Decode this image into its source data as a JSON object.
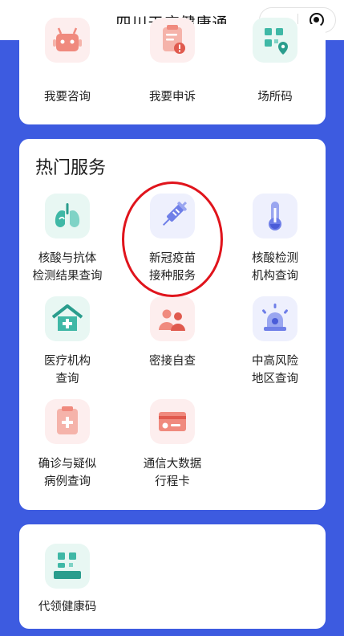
{
  "app": {
    "title": "四川天府健康通"
  },
  "top_card": {
    "items": [
      {
        "label": "我要咨询",
        "icon": "robot-icon"
      },
      {
        "label": "我要申诉",
        "icon": "complaint-clipboard-icon"
      },
      {
        "label": "场所码",
        "icon": "venue-qr-location-icon"
      }
    ]
  },
  "hot_services": {
    "title": "热门服务",
    "items": [
      {
        "label_line1": "核酸与抗体",
        "label_line2": "检测结果查询",
        "icon": "lungs-icon"
      },
      {
        "label_line1": "新冠疫苗",
        "label_line2": "接种服务",
        "icon": "syringe-icon"
      },
      {
        "label_line1": "核酸检测",
        "label_line2": "机构查询",
        "icon": "thermometer-icon"
      },
      {
        "label_line1": "医疗机构",
        "label_line2": "查询",
        "icon": "hospital-icon"
      },
      {
        "label_line1": "密接自查",
        "label_line2": "",
        "icon": "close-contact-people-icon"
      },
      {
        "label_line1": "中高风险",
        "label_line2": "地区查询",
        "icon": "alarm-light-icon"
      },
      {
        "label_line1": "确诊与疑似",
        "label_line2": "病例查询",
        "icon": "medical-clipboard-icon"
      },
      {
        "label_line1": "通信大数据",
        "label_line2": "行程卡",
        "icon": "travel-card-icon"
      }
    ]
  },
  "proxy_card": {
    "items": [
      {
        "label": "代领健康码",
        "icon": "qr-scan-icon"
      }
    ]
  },
  "colors": {
    "page_background": "#3d5be0",
    "highlight_circle": "#e0141c",
    "icon_pink": "#f08a7e",
    "icon_teal": "#3fb8a6",
    "icon_blue": "#6f7fe8"
  }
}
